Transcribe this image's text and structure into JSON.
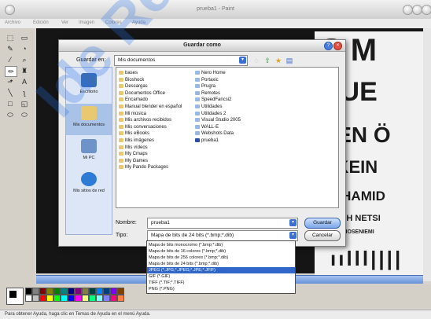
{
  "window": {
    "title": "prueba1 - Paint"
  },
  "menubar": [
    "Archivo",
    "Edición",
    "Ver",
    "Imagen",
    "Colores",
    "Ayuda"
  ],
  "poster_lines": [
    "S M",
    "HUE",
    "DEN Ö",
    "Z KEIN",
    "EL HAMID",
    "ERLEIH NETSI",
    "OHELLEHOSENIEMI"
  ],
  "dialog": {
    "title": "Guardar como",
    "save_in_label": "Guardar en:",
    "save_in_value": "Mis documentos",
    "places": [
      "Escritorio",
      "Mis documentos",
      "Mi PC",
      "Mis sitios de red"
    ],
    "files_col1": [
      "bases",
      "Bioshock",
      "Descargas",
      "Documentos Office",
      "Encarnado",
      "Manual blender en español",
      "Mi música",
      "Mis archivos recibidos",
      "Mis conversaciones",
      "Mis eBooks",
      "Mis imágenes",
      "Mis vídeos",
      "My Cmaps",
      "My Games",
      "My Pando Packages"
    ],
    "files_col2": [
      "Nero Home",
      "Portaxic",
      "Prugra",
      "Remotes",
      "SpeedFancsi2",
      "Utilidades",
      "Utilidades 2",
      "Visual Studio 2005",
      "WALL-E",
      "Webshots Data",
      "prueba1"
    ],
    "name_label": "Nombre:",
    "name_value": "prueba1",
    "type_label": "Tipo:",
    "type_value": "Mapa de bits de 24 bits (*.bmp;*.dib)",
    "save_button": "Guardar",
    "cancel_button": "Cancelar",
    "type_options": [
      "Mapa de bits monocromo (*.bmp;*.dib)",
      "Mapa de bits de 16 colores (*.bmp;*.dib)",
      "Mapa de bits de 256 colores (*.bmp;*.dib)",
      "Mapa de bits de 24 bits (*.bmp;*.dib)",
      "JPEG (*.JPG;*.JPEG;*.JPE;*.JFIF)",
      "GIF (*.GIF)",
      "TIFF (*.TIF;*.TIFF)",
      "PNG (*.PNG)"
    ],
    "selected_option_index": 4
  },
  "statusbar": {
    "text": "Para obtener Ayuda, haga clic en Temas de Ayuda en el menú Ayuda."
  },
  "watermark": "Ide Redes",
  "colors": {
    "accent": "#3166c9",
    "selection": "#a9c2e8"
  }
}
